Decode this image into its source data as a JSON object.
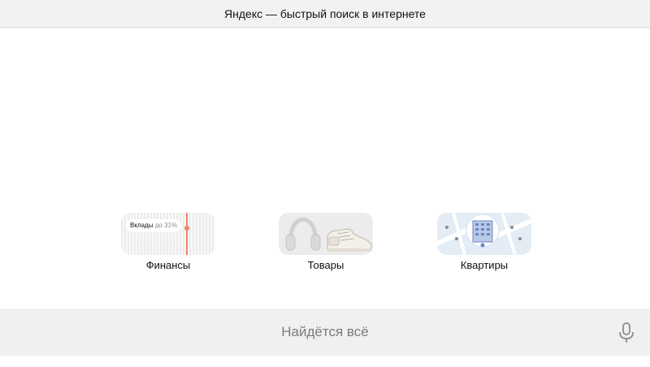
{
  "window": {
    "title": "Яндекс — быстрый поиск в интернете"
  },
  "tiles": [
    {
      "label": "Финансы",
      "badge_text": "Вклады",
      "badge_rate": "до 31%",
      "icon": "finance-chart-icon"
    },
    {
      "label": "Товары",
      "icon": "headphones-sneaker-icon"
    },
    {
      "label": "Квартиры",
      "icon": "building-map-icon"
    }
  ],
  "search": {
    "placeholder": "Найдётся всё",
    "mic_icon": "microphone-icon"
  },
  "colors": {
    "titlebar_bg": "#f2f2f2",
    "search_bg": "#f0f0f0",
    "accent_red": "#f2806e"
  }
}
